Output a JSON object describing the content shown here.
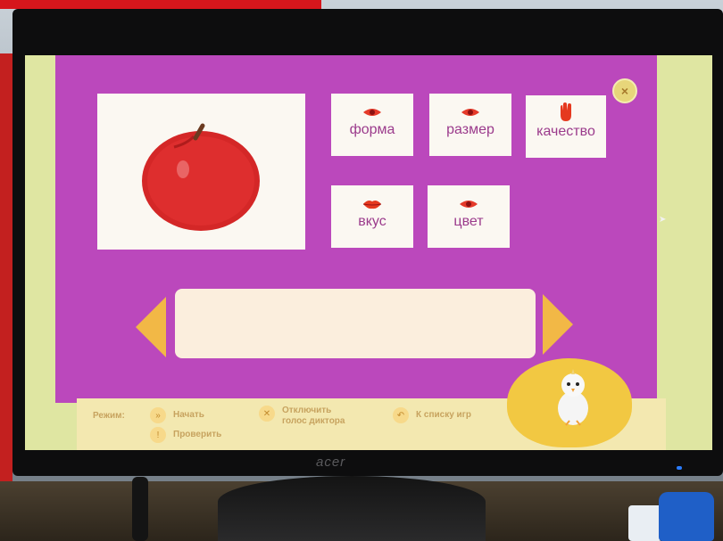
{
  "game": {
    "properties": [
      {
        "id": "forma",
        "label": "форма",
        "icon": "eye-icon"
      },
      {
        "id": "razmer",
        "label": "размер",
        "icon": "eye-icon"
      },
      {
        "id": "kachestvo",
        "label": "качество",
        "icon": "hand-icon"
      },
      {
        "id": "vkus",
        "label": "вкус",
        "icon": "lips-icon"
      },
      {
        "id": "tsvet",
        "label": "цвет",
        "icon": "eye-icon"
      }
    ],
    "picture": "apple-image",
    "answer_text": ""
  },
  "controls": {
    "mode_label": "Режим:",
    "start": "Начать",
    "check": "Проверить",
    "voice_off_line1": "Отключить",
    "voice_off_line2": "голос диктора",
    "back_to_list": "К списку игр"
  },
  "monitor": {
    "brand": "acer"
  },
  "colors": {
    "game_bg": "#bb48bc",
    "card_bg": "#fbf8f2",
    "label_text": "#9b3b8c",
    "arrow": "#f2b846",
    "apple": "#d42727",
    "bottom_bar": "#f3e8b0"
  }
}
